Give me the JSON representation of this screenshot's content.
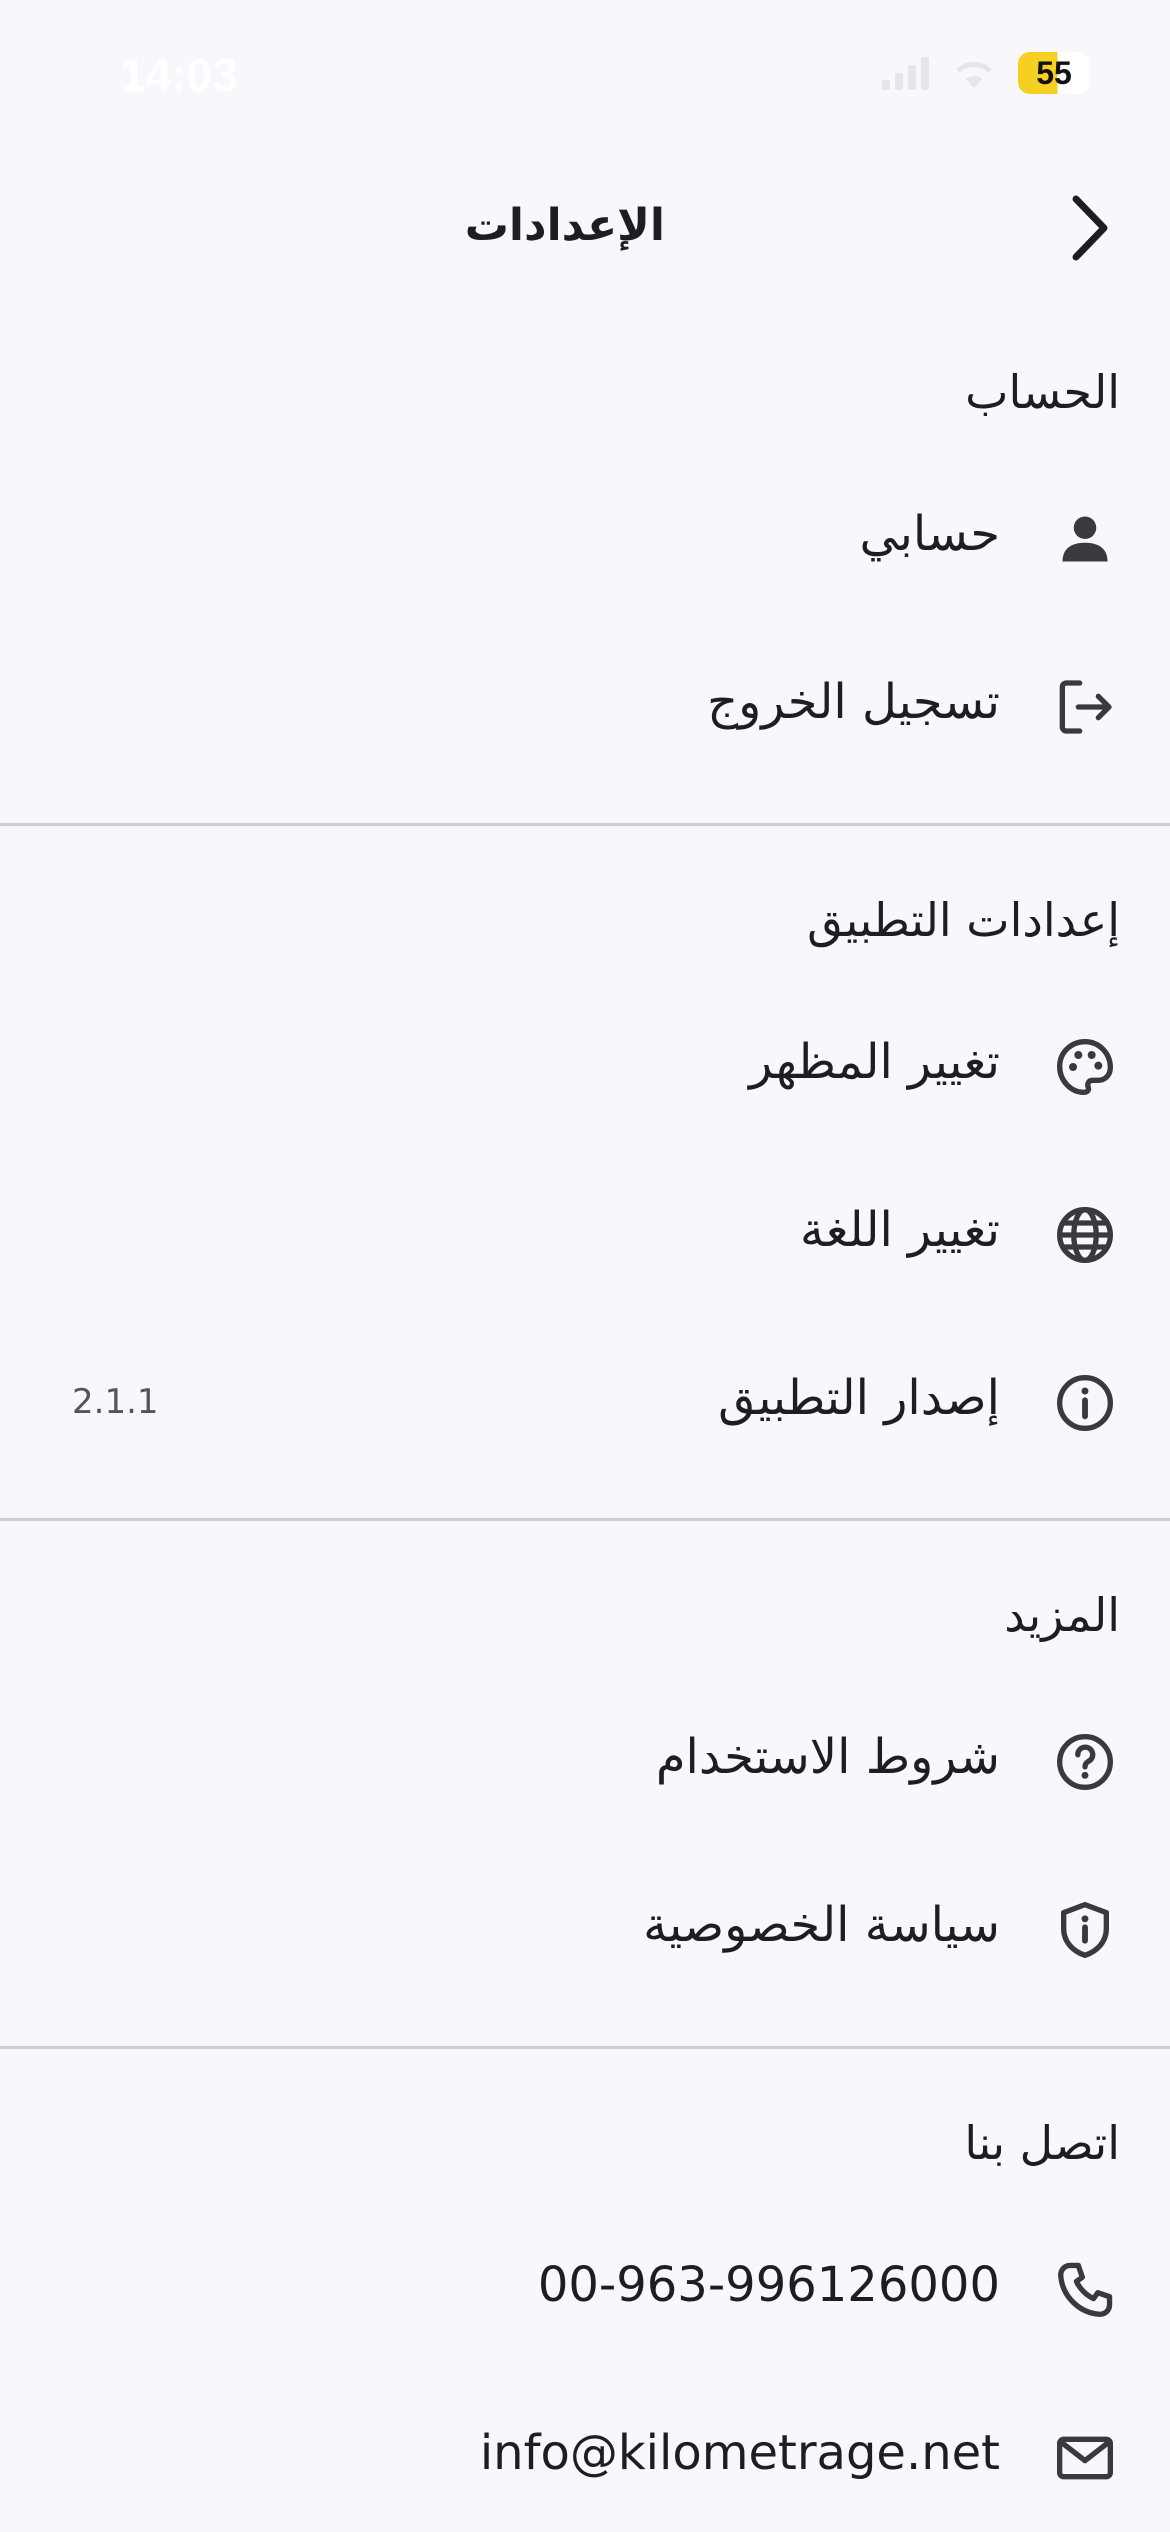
{
  "status_bar": {
    "time": "14:03",
    "battery": "55",
    "battery_color": "#f5cf22"
  },
  "header": {
    "title": "الإعدادات",
    "back_icon": "chevron-right-icon"
  },
  "sections": {
    "account": {
      "title": "الحساب",
      "items": [
        {
          "label": "حسابي",
          "icon": "person-icon"
        },
        {
          "label": "تسجيل الخروج",
          "icon": "logout-icon"
        }
      ]
    },
    "app_settings": {
      "title": "إعدادات التطبيق",
      "items": [
        {
          "label": "تغيير المظهر",
          "icon": "palette-icon"
        },
        {
          "label": "تغيير اللغة",
          "icon": "globe-icon"
        },
        {
          "label": "إصدار التطبيق",
          "icon": "info-icon",
          "value": "2.1.1"
        }
      ]
    },
    "more": {
      "title": "المزيد",
      "items": [
        {
          "label": "شروط الاستخدام",
          "icon": "question-circle-icon"
        },
        {
          "label": "سياسة الخصوصية",
          "icon": "shield-info-icon"
        }
      ]
    },
    "contact": {
      "title": "اتصل بنا",
      "items": [
        {
          "label": "00-963-996126000",
          "icon": "phone-icon"
        },
        {
          "label": "info@kilometrage.net",
          "icon": "mail-icon"
        }
      ]
    }
  }
}
